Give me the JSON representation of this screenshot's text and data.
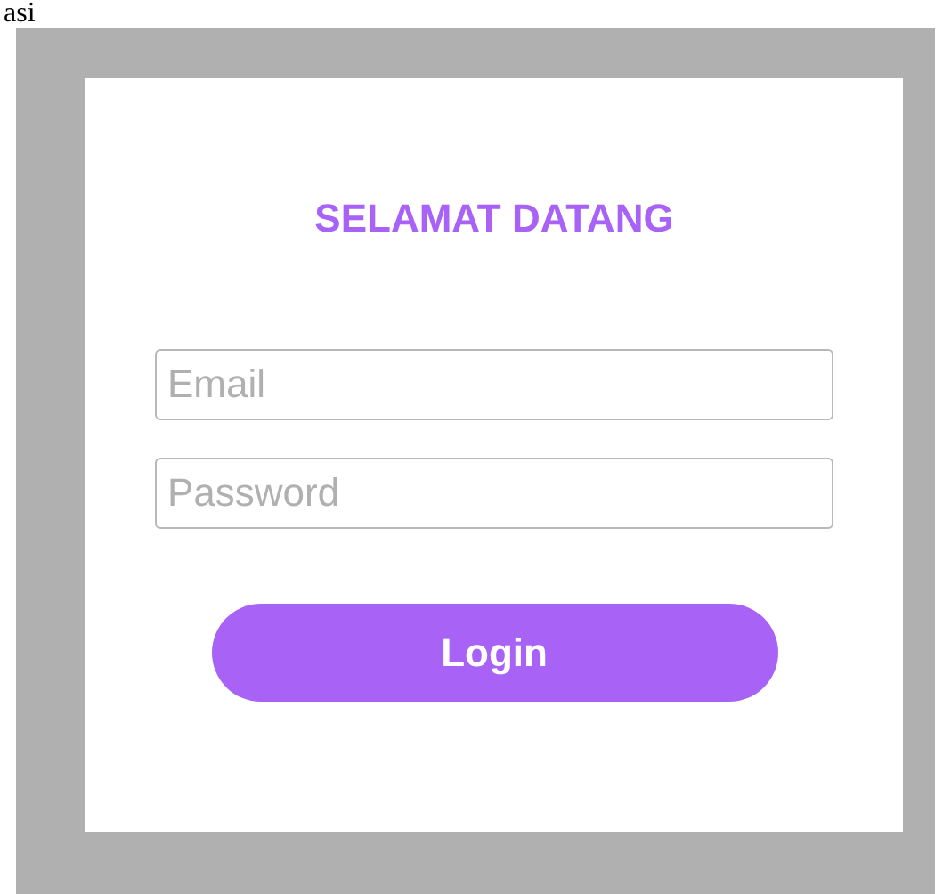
{
  "caption": "asi",
  "title": "SELAMAT DATANG",
  "fields": [
    {
      "placeholder": "Email"
    },
    {
      "placeholder": "Password"
    }
  ],
  "button": "Login"
}
